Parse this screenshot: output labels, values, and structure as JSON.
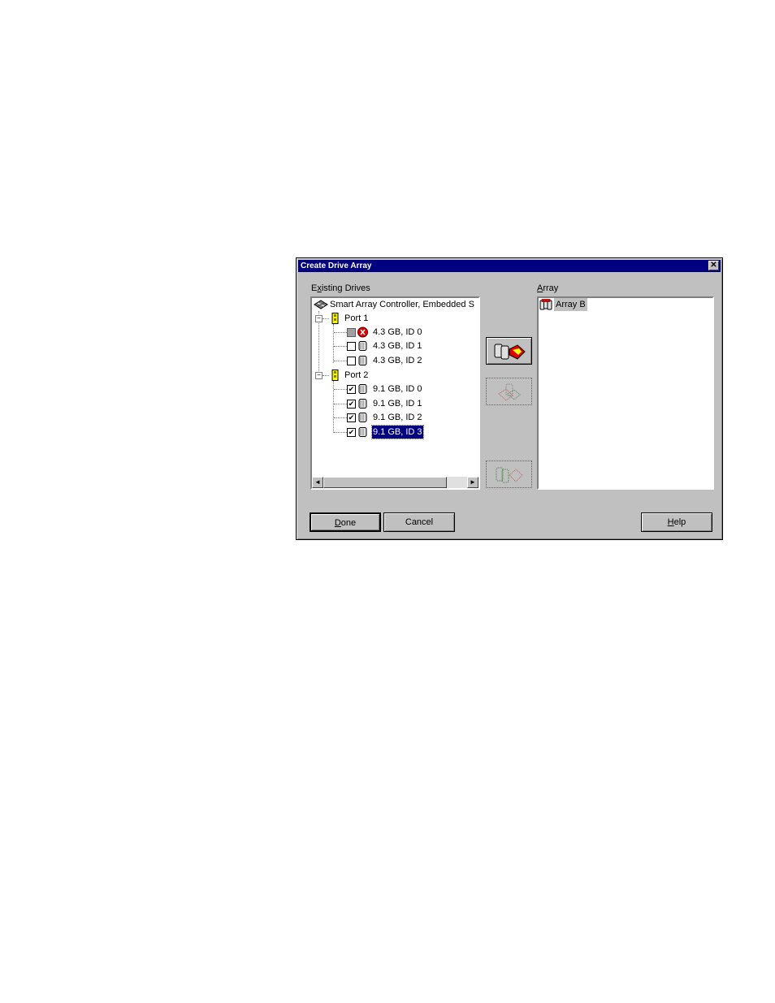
{
  "dialog": {
    "title": "Create Drive Array",
    "close_glyph": "✕",
    "existing_drives_label_pre": "E",
    "existing_drives_label_u": "x",
    "existing_drives_label_post": "isting Drives",
    "array_label_u": "A",
    "array_label_post": "rray"
  },
  "tree": {
    "controller": "Smart Array Controller, Embedded S",
    "ports": [
      {
        "label": "Port 1",
        "drives": [
          {
            "label": "4.3 GB, ID 0",
            "state": "grey",
            "failed": true
          },
          {
            "label": "4.3 GB, ID 1",
            "state": "unchecked"
          },
          {
            "label": "4.3 GB, ID 2",
            "state": "unchecked"
          }
        ]
      },
      {
        "label": "Port 2",
        "drives": [
          {
            "label": "9.1 GB, ID 0",
            "state": "checked"
          },
          {
            "label": "9.1 GB, ID 1",
            "state": "checked"
          },
          {
            "label": "9.1 GB, ID 2",
            "state": "checked"
          },
          {
            "label": "9.1 GB, ID 3",
            "state": "checked",
            "selected": true
          }
        ]
      }
    ],
    "check_glyph": "✔",
    "expander_glyph": "−",
    "scroll_left": "◄",
    "scroll_right": "►"
  },
  "array_list": {
    "items": [
      "Array B"
    ]
  },
  "buttons": {
    "done_u": "D",
    "done_post": "one",
    "cancel": "Cancel",
    "help_u": "H",
    "help_post": "elp"
  },
  "icons": {
    "controller": "controller-chip-icon",
    "port": "port-connector-icon",
    "drive": "hard-drive-icon",
    "failed": "failed-drive-icon",
    "array": "array-icon",
    "add": "add-drive-to-array-icon",
    "remove": "remove-drive-icon",
    "spare": "spare-drive-icon"
  },
  "colors": {
    "titlebar": "#000080",
    "face": "#c0c0c0",
    "selection": "#000080",
    "failed": "#e00000"
  }
}
